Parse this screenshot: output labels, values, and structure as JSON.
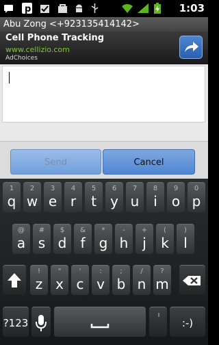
{
  "status_bar": {
    "time": "1:03",
    "icons": [
      "sms-icon",
      "p-icon",
      "check-icon",
      "bag-icon",
      "android-icon",
      "usb-icon",
      "wifi-icon",
      "signal-icon",
      "battery-icon"
    ]
  },
  "conversation": {
    "title": "Abu Zong <+923135414142>"
  },
  "ad": {
    "title": "Cell Phone Tracking",
    "url": "www.cellizio.com",
    "choices": "AdChoices"
  },
  "compose": {
    "value": ""
  },
  "buttons": {
    "send": "Send",
    "cancel": "Cancel"
  },
  "keyboard": {
    "row1": [
      {
        "main": "q",
        "alt": "1"
      },
      {
        "main": "w",
        "alt": "2"
      },
      {
        "main": "e",
        "alt": "3"
      },
      {
        "main": "r",
        "alt": "4"
      },
      {
        "main": "t",
        "alt": "5"
      },
      {
        "main": "y",
        "alt": "6"
      },
      {
        "main": "u",
        "alt": "7"
      },
      {
        "main": "i",
        "alt": "8"
      },
      {
        "main": "o",
        "alt": "9"
      },
      {
        "main": "p",
        "alt": "0"
      }
    ],
    "row2": [
      {
        "main": "a",
        "alt": "@"
      },
      {
        "main": "s",
        "alt": "#"
      },
      {
        "main": "d",
        "alt": "$"
      },
      {
        "main": "f",
        "alt": "&"
      },
      {
        "main": "g",
        "alt": "*"
      },
      {
        "main": "h",
        "alt": "-"
      },
      {
        "main": "j",
        "alt": "+"
      },
      {
        "main": "k",
        "alt": "("
      },
      {
        "main": "l",
        "alt": ")"
      }
    ],
    "row3": [
      {
        "main": "z",
        "alt": "!"
      },
      {
        "main": "x",
        "alt": "\""
      },
      {
        "main": "c",
        "alt": "'"
      },
      {
        "main": "v",
        "alt": ":"
      },
      {
        "main": "b",
        "alt": ";"
      },
      {
        "main": "n",
        "alt": "/"
      },
      {
        "main": "m",
        "alt": "?"
      }
    ],
    "symbols_label": "?123",
    "enter_label": ":-)"
  }
}
